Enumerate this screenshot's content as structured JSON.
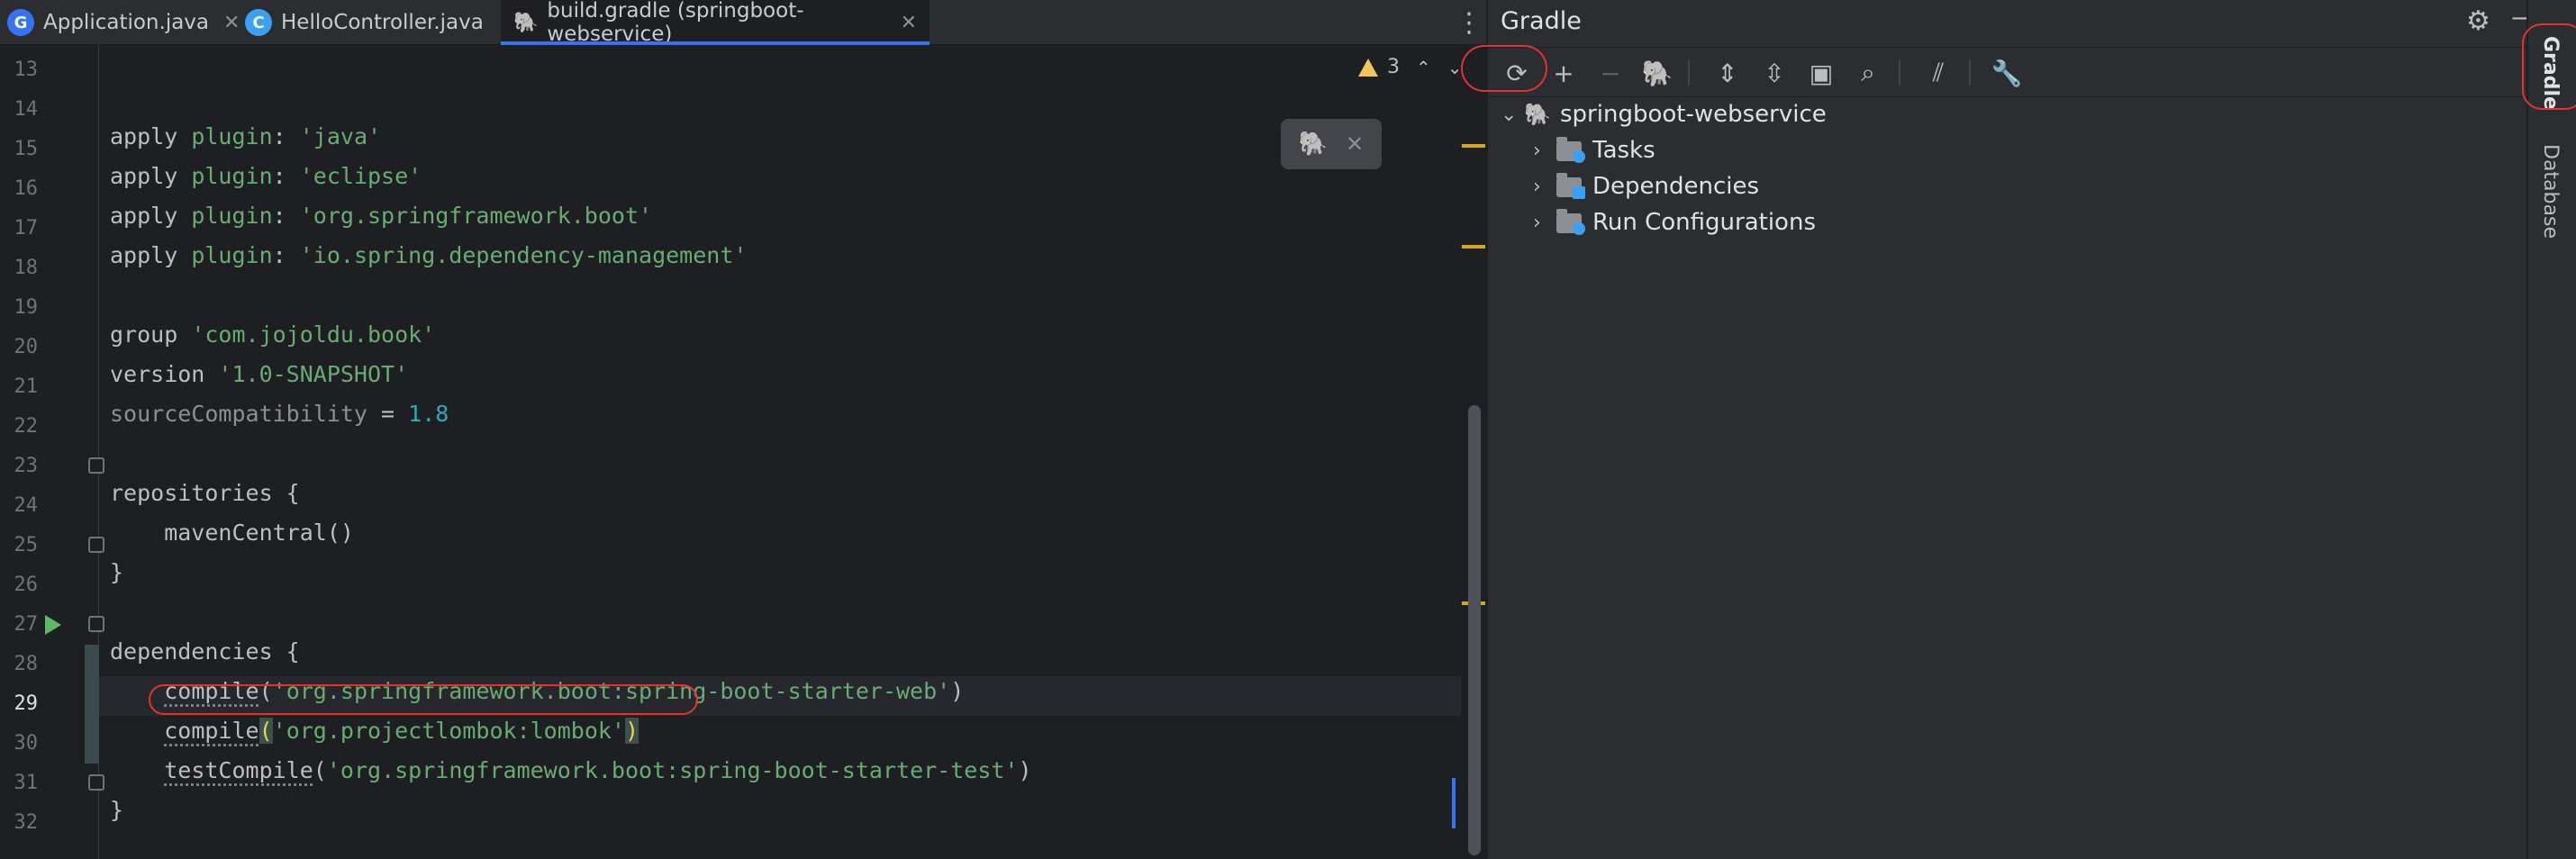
{
  "tabs": [
    {
      "label": "Application.java",
      "icon": "java-app-icon",
      "icon_letter": "G",
      "icon_color": "#3574f0"
    },
    {
      "label": "HelloController.java",
      "icon": "java-class-icon",
      "icon_letter": "C",
      "icon_color": "#3aa1f2"
    },
    {
      "label": "build.gradle (springboot-webservice)",
      "icon": "gradle-elephant-icon",
      "icon_letter": "🐘",
      "icon_color": "#8c8f94"
    }
  ],
  "tab_close_glyph": "✕",
  "more_glyph": "⋮",
  "line_numbers": [
    "13",
    "14",
    "15",
    "16",
    "17",
    "18",
    "19",
    "20",
    "21",
    "22",
    "23",
    "24",
    "25",
    "26",
    "27",
    "28",
    "29",
    "30",
    "31",
    "32"
  ],
  "code": {
    "l14": {
      "a": "apply ",
      "b": "plugin",
      "c": ": ",
      "d": "'java'"
    },
    "l15": {
      "a": "apply ",
      "b": "plugin",
      "c": ": ",
      "d": "'eclipse'"
    },
    "l16": {
      "a": "apply ",
      "b": "plugin",
      "c": ": ",
      "d": "'org.springframework.boot'"
    },
    "l17": {
      "a": "apply ",
      "b": "plugin",
      "c": ": ",
      "d": "'io.spring.dependency-management'"
    },
    "l19": {
      "a": "group ",
      "d": "'com.jojoldu.book'"
    },
    "l20": {
      "a": "version ",
      "d": "'1.0-SNAPSHOT'"
    },
    "l21": {
      "a": "sourceCompatibility",
      "c": " = ",
      "n": "1.8"
    },
    "l23": {
      "a": "repositories {"
    },
    "l24": {
      "a": "    mavenCentral()"
    },
    "l25": {
      "a": "}"
    },
    "l27": {
      "a": "dependencies {"
    },
    "l28": {
      "i": "    ",
      "m": "compile",
      "p1": "(",
      "d": "'org.springframework.boot:spring-boot-starter-web'",
      "p2": ")"
    },
    "l29": {
      "i": "    ",
      "m": "compile",
      "p1": "(",
      "d": "'org.projectlombok:lombok'",
      "p2": ")"
    },
    "l30": {
      "i": "    ",
      "m": "testCompile",
      "p1": "(",
      "d": "'org.springframework.boot:spring-boot-starter-test'",
      "p2": ")"
    },
    "l31": {
      "a": "}"
    }
  },
  "inspections": {
    "warning_count": "3",
    "up": "⌃",
    "down": "⌄"
  },
  "gradle_popup": {
    "icon": "gradle-refresh-icon",
    "glyph": "🐘",
    "close": "✕"
  },
  "gradle_panel": {
    "title": "Gradle",
    "gear": "⚙",
    "minimize": "—",
    "toolbar": [
      {
        "name": "reload-all-gradle-projects-icon",
        "glyph": "⟳"
      },
      {
        "name": "add-project-icon",
        "glyph": "+"
      },
      {
        "name": "remove-project-icon",
        "glyph": "−"
      },
      {
        "name": "execute-gradle-task-icon",
        "glyph": "🐘"
      },
      {
        "name": "expand-all-icon",
        "glyph": "⇕"
      },
      {
        "name": "collapse-all-icon",
        "glyph": "⇳"
      },
      {
        "name": "group-modules-icon",
        "glyph": "▣"
      },
      {
        "name": "search-icon",
        "glyph": "⌕"
      },
      {
        "name": "toggle-offline-mode-icon",
        "glyph": "⫽"
      },
      {
        "name": "build-tool-settings-icon",
        "glyph": "🔧"
      }
    ],
    "tree": {
      "root": "springboot-webservice",
      "children": [
        {
          "label": "Tasks",
          "badge_color": "#3aa1f2"
        },
        {
          "label": "Dependencies",
          "badge_color": "#3aa1f2"
        },
        {
          "label": "Run Configurations",
          "badge_color": "#3aa1f2"
        }
      ],
      "expanded_glyph": "⌄",
      "collapsed_glyph": "›"
    }
  },
  "right_stripe": {
    "gradle": "Gradle",
    "database": "Database"
  }
}
